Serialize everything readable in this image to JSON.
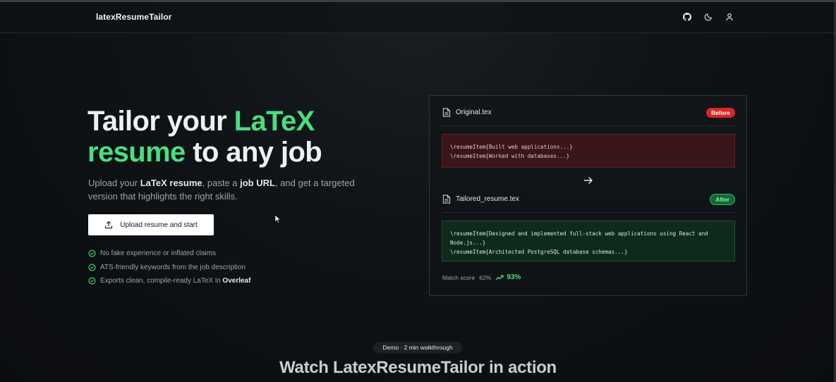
{
  "nav": {
    "brand": "latexResumeTailor",
    "icons": [
      "github-icon",
      "moon-icon",
      "user-icon"
    ]
  },
  "hero": {
    "title_part1": "Tailor your ",
    "title_highlight": "LaTeX resume",
    "title_part2": " to any job",
    "sub_1": "Upload your ",
    "sub_b1": "LaTeX resume",
    "sub_2": ", paste a ",
    "sub_b2": "job URL",
    "sub_3": ", and get a targeted version that highlights the right skills.",
    "upload_label": "Upload resume and start",
    "features": [
      "No fake experience or inflated claims",
      "ATS-friendly keywords from the job description",
      "Exports clean, compile-ready LaTeX in "
    ],
    "feature_3_bold": "Overleaf"
  },
  "preview": {
    "original_name": "Original.tex",
    "before_label": "Before",
    "original_lines": [
      "\\resumeItem{Built web applications...}",
      "\\resumeItem{Worked with databases...}"
    ],
    "tailored_name": "Tailored_resume.tex",
    "after_label": "After",
    "tailored_lines": [
      "\\resumeItem{Designed and implemented full-stack web applications using React and",
      "Node.js...}",
      "\\resumeItem{Architected PostgreSQL database schemas...}"
    ],
    "score_label": "Match score",
    "score_old": "62%",
    "score_new": "93%"
  },
  "demo": {
    "pill": "Demo · 2 min walkthrough",
    "heading": "Watch LatexResumeTailor in action"
  },
  "colors": {
    "accent_green": "#4ade80",
    "before_red": "#dc2626",
    "after_green": "#166534"
  }
}
